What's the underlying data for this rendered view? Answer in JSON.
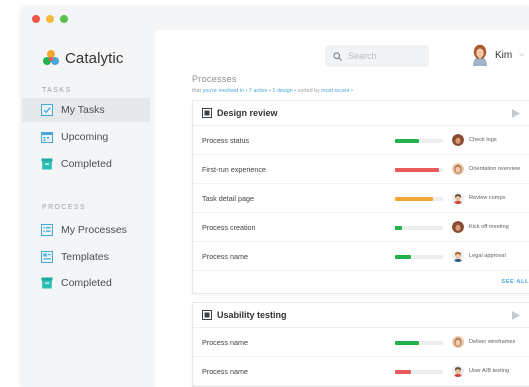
{
  "colors": {
    "green": "#23b14d",
    "red": "#ea5a5d",
    "orange": "#f2a531",
    "accent": "#4aa6d8"
  },
  "brand": {
    "name": "Catalytic"
  },
  "sidebar": {
    "tasks_label": "TASKS",
    "tasks": [
      {
        "label": "My Tasks",
        "icon": "checkbox-icon",
        "active": true
      },
      {
        "label": "Upcoming",
        "icon": "calendar-icon",
        "active": false
      },
      {
        "label": "Completed",
        "icon": "archive-icon",
        "active": false
      }
    ],
    "process_label": "PROCESS",
    "process": [
      {
        "label": "My Processes",
        "icon": "list-icon"
      },
      {
        "label": "Templates",
        "icon": "template-icon"
      },
      {
        "label": "Completed",
        "icon": "archive-icon"
      }
    ]
  },
  "header": {
    "search_placeholder": "Search",
    "user_name": "Kim"
  },
  "main": {
    "title": "Processes",
    "filter": {
      "p1": "that",
      "l1": "you're involved in",
      "p2": "•",
      "l2": "7 active",
      "p3": "•",
      "l3": "1 design",
      "p4": "• sorted by",
      "l4": "most recent",
      "p5": "•"
    }
  },
  "groups": [
    {
      "title": "Design review",
      "see_all": "SEE ALL",
      "rows": [
        {
          "name": "Process status",
          "progress": 0.5,
          "color": "green",
          "task": "Check logs",
          "avatar": "woman-a"
        },
        {
          "name": "First-run experience",
          "progress": 0.92,
          "color": "red",
          "task": "Orientation overview",
          "avatar": "woman-b"
        },
        {
          "name": "Task detail page",
          "progress": 0.8,
          "color": "orange",
          "task": "Review comps",
          "avatar": "man-a"
        },
        {
          "name": "Process creation",
          "progress": 0.15,
          "color": "green",
          "task": "Kick off meeting",
          "avatar": "woman-a"
        },
        {
          "name": "Process name",
          "progress": 0.33,
          "color": "green",
          "task": "Legal approval",
          "avatar": "man-b"
        }
      ]
    },
    {
      "title": "Usability testing",
      "rows": [
        {
          "name": "Process name",
          "progress": 0.5,
          "color": "green",
          "task": "Deliver wireframes",
          "avatar": "woman-b"
        },
        {
          "name": "Process name",
          "progress": 0.33,
          "color": "red",
          "task": "User A/B testing",
          "avatar": "man-a"
        }
      ]
    }
  ]
}
